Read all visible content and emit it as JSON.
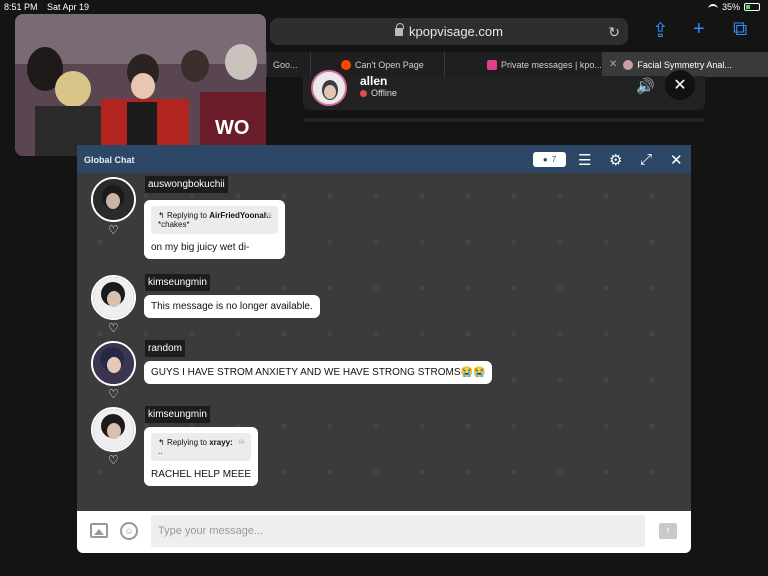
{
  "status_bar": {
    "time": "8:51 PM",
    "date": "Sat Apr 19",
    "battery": "35%",
    "battery_level": 0.35
  },
  "browser": {
    "url": "kpopvisage.com",
    "tabs": [
      {
        "label": "Goo...",
        "favicon": "google-icon",
        "active": false
      },
      {
        "label": "Can't Open Page",
        "favicon": "reddit-icon",
        "active": false
      },
      {
        "label": "Private messages | kpo...",
        "favicon": "kpopvisage-icon",
        "active": false
      },
      {
        "label": "Facial Symmetry Anal...",
        "favicon": "face-icon",
        "active": true
      }
    ]
  },
  "call": {
    "name": "allen",
    "status": "Offline"
  },
  "chat": {
    "title": "Global Chat",
    "online_count": "7",
    "messages": [
      {
        "username": "auswongbokuchii",
        "reply_to": "AirFriedYoonah:",
        "reply_label": "Replying to",
        "reply_text": "*chakes*",
        "text": "on my big juicy wet di-"
      },
      {
        "username": "kimseungmin",
        "text": "This message is no longer available."
      },
      {
        "username": "random",
        "text": "GUYS I HAVE STROM ANXIETY AND WE HAVE STRONG STROMS😭😭"
      },
      {
        "username": "kimseungmin",
        "reply_to": "xrayy:",
        "reply_label": "Replying to",
        "reply_text": "..",
        "text": "RACHEL HELP MEEE"
      }
    ],
    "input_placeholder": "Type your message..."
  },
  "colors": {
    "chat_header": "#2d4866",
    "chat_bg": "#3b3b3b",
    "accent": "#2f8cff",
    "offline": "#e24b4b"
  }
}
